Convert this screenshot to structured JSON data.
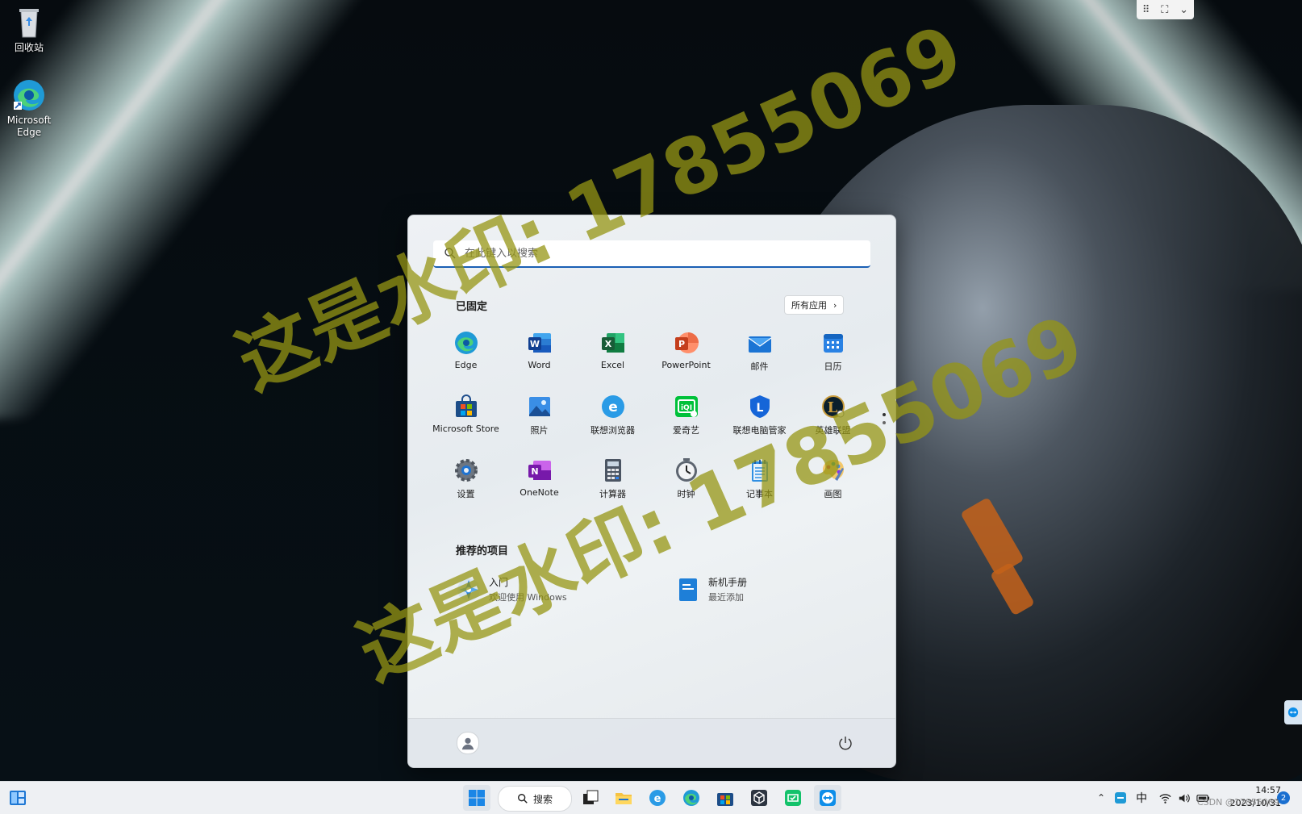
{
  "desktop": {
    "icons": [
      {
        "label": "回收站",
        "icon": "recycle-bin-icon"
      },
      {
        "label_line1": "Microsoft",
        "label_line2": "Edge",
        "icon": "edge-icon"
      }
    ],
    "watermark_1": "这是水印: 17855069",
    "watermark_2": "这是水印: 17855069"
  },
  "remote_toolbar": {
    "icons": [
      "drag-handle-icon",
      "fullscreen-icon",
      "chevron-down-icon"
    ]
  },
  "start_menu": {
    "search_placeholder": "在此键入以搜索",
    "pinned_title": "已固定",
    "all_apps_label": "所有应用",
    "pinned": [
      {
        "label": "Edge",
        "icon": "edge-icon"
      },
      {
        "label": "Word",
        "icon": "word-icon"
      },
      {
        "label": "Excel",
        "icon": "excel-icon"
      },
      {
        "label": "PowerPoint",
        "icon": "powerpoint-icon"
      },
      {
        "label": "邮件",
        "icon": "mail-icon"
      },
      {
        "label": "日历",
        "icon": "calendar-icon"
      },
      {
        "label": "Microsoft Store",
        "icon": "store-icon"
      },
      {
        "label": "照片",
        "icon": "photos-icon"
      },
      {
        "label": "联想浏览器",
        "icon": "lenovo-browser-icon"
      },
      {
        "label": "爱奇艺",
        "icon": "iqiyi-icon"
      },
      {
        "label": "联想电脑管家",
        "icon": "lenovo-manager-icon"
      },
      {
        "label": "英雄联盟",
        "icon": "lol-icon"
      },
      {
        "label": "设置",
        "icon": "settings-icon"
      },
      {
        "label": "OneNote",
        "icon": "onenote-icon"
      },
      {
        "label": "计算器",
        "icon": "calculator-icon"
      },
      {
        "label": "时钟",
        "icon": "clock-icon"
      },
      {
        "label": "记事本",
        "icon": "notepad-icon"
      },
      {
        "label": "画图",
        "icon": "paint-icon"
      }
    ],
    "recommended_title": "推荐的项目",
    "recommended": [
      {
        "title": "入门",
        "subtitle": "欢迎使用 Windows",
        "icon": "get-started-icon"
      },
      {
        "title": "新机手册",
        "subtitle": "最近添加",
        "icon": "manual-icon"
      }
    ],
    "user_icon": "user-avatar-icon",
    "power_icon": "power-icon"
  },
  "taskbar": {
    "search_label": "搜索",
    "apps": [
      "widgets-icon",
      "start-icon",
      "task-view-icon",
      "file-explorer-icon",
      "lenovo-browser-icon",
      "edge-icon",
      "store-icon",
      "cube-app-icon",
      "wechat-like-icon",
      "teamviewer-icon"
    ],
    "tray": {
      "ime": "中",
      "time": "14:57",
      "date": "2023/10/31",
      "notification_count": "2"
    },
    "overlay_text": "CSDN @17855069"
  }
}
